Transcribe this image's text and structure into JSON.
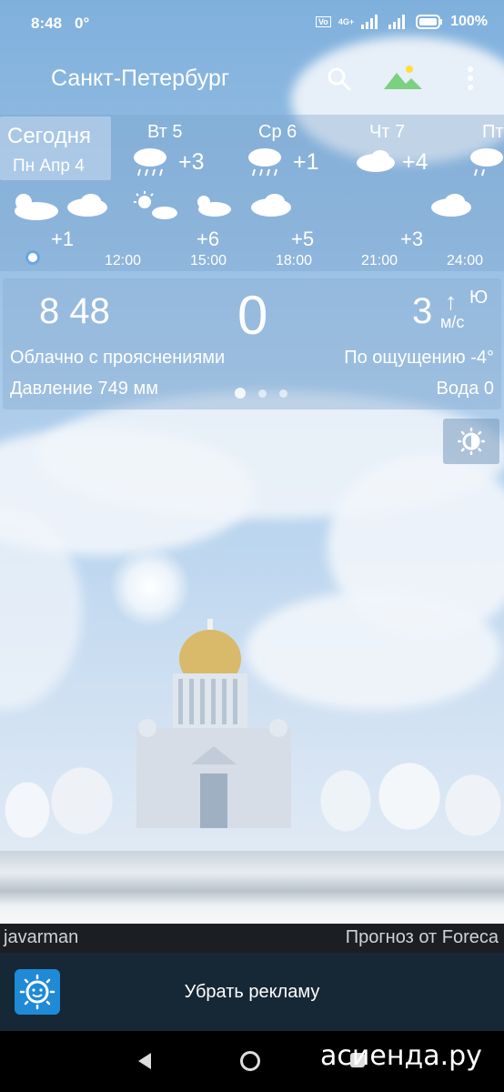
{
  "status_bar": {
    "time": "8:48",
    "temp": "0°",
    "battery": "100%",
    "network": "4G+"
  },
  "app_bar": {
    "title": "Санкт-Петербург"
  },
  "daily": [
    {
      "name": "Сегодня",
      "sub": "Пн Апр 4",
      "selected": true
    },
    {
      "name": "Вт 5",
      "temp": "+3",
      "icon": "rain-cloud-icon"
    },
    {
      "name": "Ср 6",
      "temp": "+1",
      "icon": "rain-cloud-icon"
    },
    {
      "name": "Чт 7",
      "temp": "+4",
      "icon": "cloud-icon"
    },
    {
      "name": "Пт",
      "icon": "rain-cloud-icon"
    }
  ],
  "hourly": {
    "temps": [
      "+1",
      "+6",
      "+5",
      "+3"
    ],
    "times": [
      "12:00",
      "15:00",
      "18:00",
      "21:00",
      "24:00"
    ]
  },
  "current": {
    "clock": "8 48",
    "temperature": "0",
    "wind_speed": "3",
    "wind_dir": "Ю",
    "wind_unit": "м/с",
    "condition": "Облачно с прояснениями",
    "feels_like": "По ощущению -4°",
    "pressure": "Давление 749 мм",
    "water": "Вода 0"
  },
  "credits": {
    "user": "javarman",
    "provider": "Прогноз от Foreca"
  },
  "ad": {
    "label": "Убрать рекламу"
  },
  "watermark": "асиенда.ру",
  "colors": {
    "accent": "#6ba7dc",
    "ad_bg": "#162736",
    "credits_bg": "#1b1f24"
  }
}
